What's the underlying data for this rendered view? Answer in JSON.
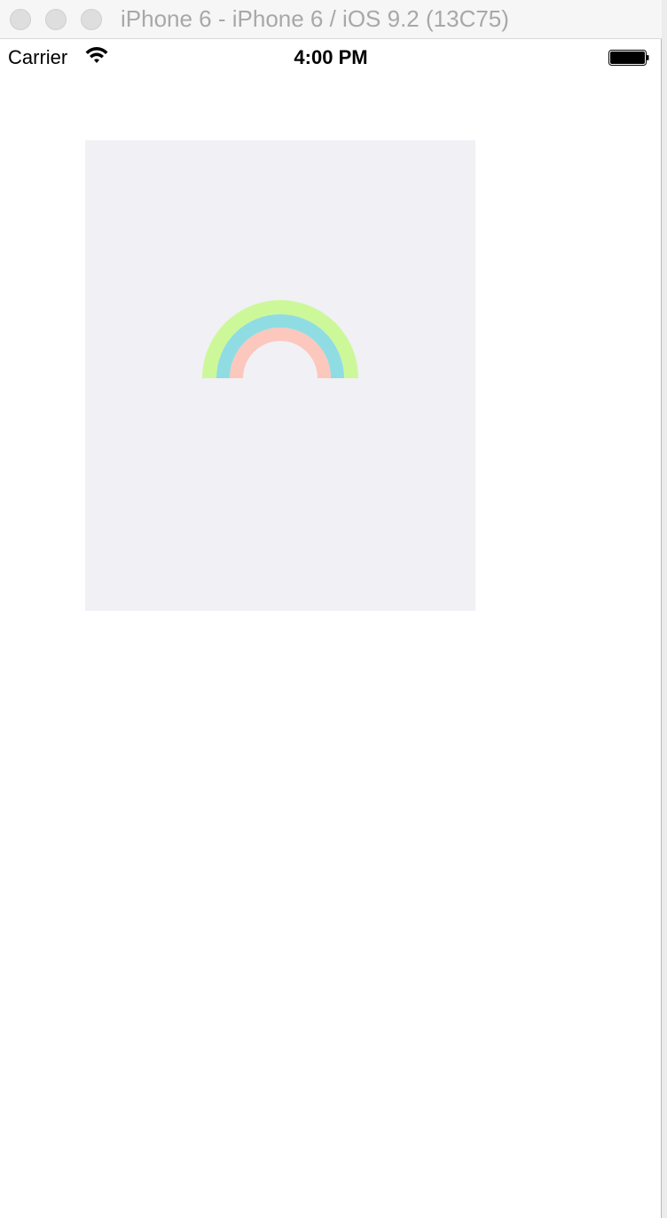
{
  "window": {
    "title": "iPhone 6 - iPhone 6 / iOS 9.2 (13C75)"
  },
  "statusbar": {
    "carrier": "Carrier",
    "time": "4:00 PM",
    "wifi_icon": "wifi-icon",
    "battery_icon": "battery-icon"
  },
  "canvas": {
    "background": "#f1f0f5",
    "arcs": [
      {
        "name": "outer-arc",
        "color": "#cdf89a"
      },
      {
        "name": "middle-arc",
        "color": "#8fdde3"
      },
      {
        "name": "inner-arc",
        "color": "#fcc7bd"
      }
    ]
  }
}
